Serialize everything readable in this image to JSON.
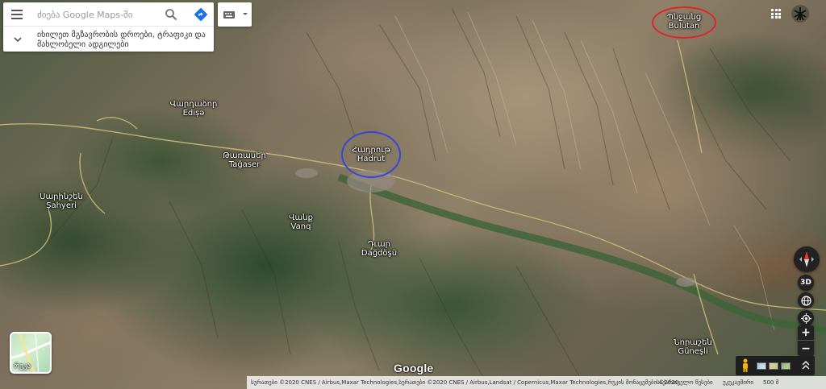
{
  "search": {
    "placeholder": "ძიება Google Maps-ში"
  },
  "traffic_prompt": "იხილეთ მგზავრობის დროები, ტრაფიკი და მახლობელი ადგილები",
  "places": [
    {
      "id": "hadrut",
      "native": "Հադրութ",
      "latin": "Hadrut",
      "highlight": "blue"
    },
    {
      "id": "bulutan",
      "native": "Պնջանց",
      "latin": "Bulutan",
      "highlight": "red"
    },
    {
      "id": "edise",
      "native": "Վարդաձոր",
      "latin": "Ediṣə"
    },
    {
      "id": "tagaser",
      "native": "Թառասեր",
      "latin": "Tağaser"
    },
    {
      "id": "sahyeri",
      "native": "Սարինշեն",
      "latin": "Şahyeri"
    },
    {
      "id": "vanq",
      "native": "Վանք",
      "latin": "Vanq"
    },
    {
      "id": "dagdosu",
      "native": "Դւար",
      "latin": "Dağdöşü"
    },
    {
      "id": "gunesli",
      "native": "Նորաշեն",
      "latin": "Güneşli"
    }
  ],
  "controls": {
    "three_d_label": "3D",
    "zoom_in_label": "+",
    "zoom_out_label": "−"
  },
  "layers": {
    "label": "რუკა"
  },
  "logo_text": "Google",
  "attribution": {
    "imagery": "სურათები ©2020 CNES / Airbus,Maxar Technologies,სურათები ©2020 CNES / Airbus,Landsat / Copernicus,Maxar Technologies,რუკის მონაცემები ©2020",
    "links": [
      "საქართველო",
      "წესები",
      "უკუკავშირი"
    ],
    "scale": "500 მ"
  },
  "colors": {
    "blue_circle": "#3547d8",
    "red_circle": "#e0242a",
    "directions_blue": "#1a73e8"
  }
}
